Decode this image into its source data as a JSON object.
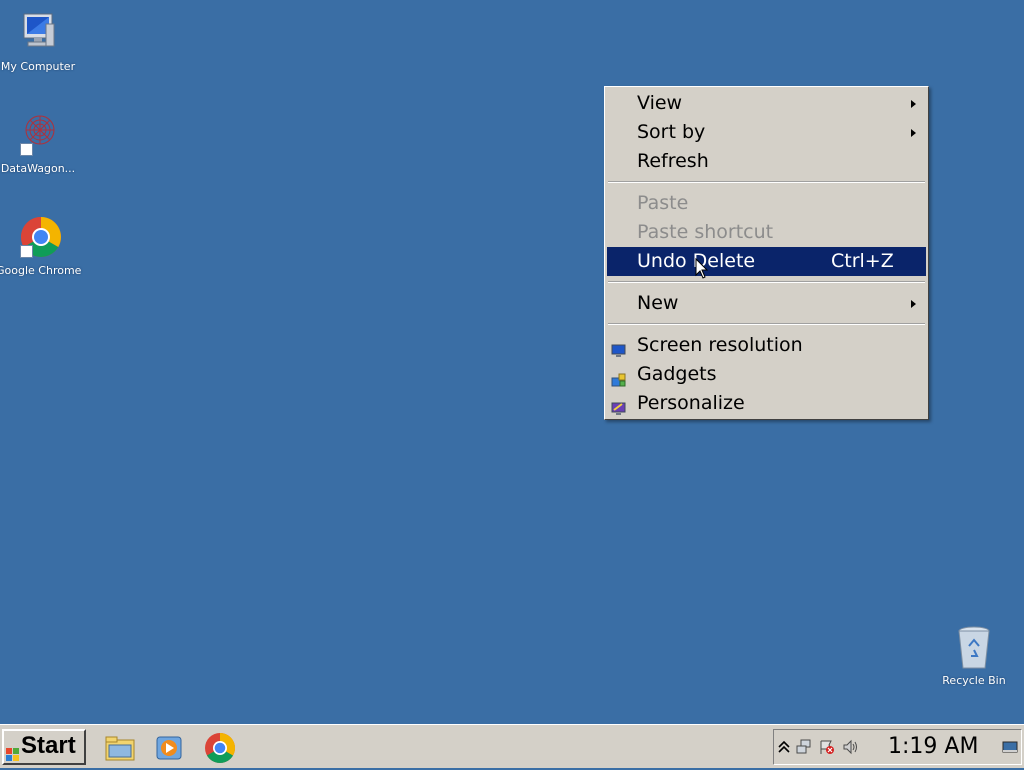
{
  "desktop": {
    "background_color": "#3a6ea5",
    "icons": [
      {
        "label": "My Computer",
        "icon": "my-computer-icon"
      },
      {
        "label": "DataWagon...",
        "icon": "datawagon-icon"
      },
      {
        "label": "Google Chrome",
        "icon": "chrome-icon"
      },
      {
        "label": "Recycle Bin",
        "icon": "recycle-bin-icon"
      }
    ]
  },
  "context_menu": {
    "items": [
      {
        "label": "View",
        "submenu": true
      },
      {
        "label": "Sort by",
        "submenu": true
      },
      {
        "label": "Refresh"
      },
      {
        "label": "Paste",
        "disabled": true
      },
      {
        "label": "Paste shortcut",
        "disabled": true
      },
      {
        "label": "Undo Delete",
        "shortcut": "Ctrl+Z",
        "highlighted": true
      },
      {
        "label": "New",
        "submenu": true
      },
      {
        "label": "Screen resolution",
        "icon": "screen-resolution-icon"
      },
      {
        "label": "Gadgets",
        "icon": "gadgets-icon"
      },
      {
        "label": "Personalize",
        "icon": "personalize-icon"
      }
    ],
    "highlight_color": "#0a246a"
  },
  "taskbar": {
    "start_label": "Start",
    "quick_launch": [
      "file-explorer-icon",
      "media-player-icon",
      "chrome-icon"
    ],
    "tray_icons": [
      "show-hidden-icons-chevron",
      "network-icon",
      "action-center-flag-icon",
      "volume-icon",
      "show-desktop-icon"
    ],
    "clock": "1:19 AM"
  }
}
